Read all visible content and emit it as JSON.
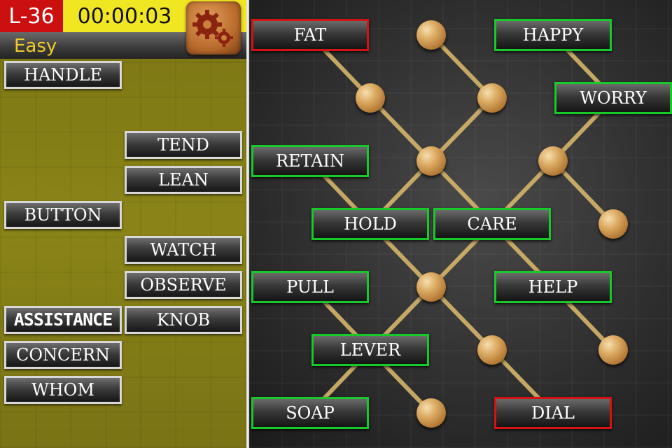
{
  "header": {
    "level": "L-36",
    "timer": "00:00:03",
    "difficulty": "Easy",
    "settings_icon": "gears-icon"
  },
  "word_bank": [
    {
      "word": "HANDLE"
    },
    {
      "word": "TEND"
    },
    {
      "word": "LEAN"
    },
    {
      "word": "BUTTON"
    },
    {
      "word": "WATCH"
    },
    {
      "word": "OBSERVE"
    },
    {
      "word": "ASSISTANCE"
    },
    {
      "word": "KNOB"
    },
    {
      "word": "CONCERN"
    },
    {
      "word": "WHOM"
    }
  ],
  "board": {
    "words": [
      {
        "word": "FAT",
        "status": "incorrect"
      },
      {
        "word": "HAPPY",
        "status": "correct"
      },
      {
        "word": "WORRY",
        "status": "correct"
      },
      {
        "word": "RETAIN",
        "status": "correct"
      },
      {
        "word": "HOLD",
        "status": "correct"
      },
      {
        "word": "CARE",
        "status": "correct"
      },
      {
        "word": "PULL",
        "status": "correct"
      },
      {
        "word": "HELP",
        "status": "correct"
      },
      {
        "word": "LEVER",
        "status": "correct"
      },
      {
        "word": "SOAP",
        "status": "correct"
      },
      {
        "word": "DIAL",
        "status": "incorrect"
      }
    ],
    "status_colors": {
      "correct": "#18c92a",
      "incorrect": "#d41414"
    },
    "link_color": "#d6b56a",
    "empty_node_count": 12
  }
}
